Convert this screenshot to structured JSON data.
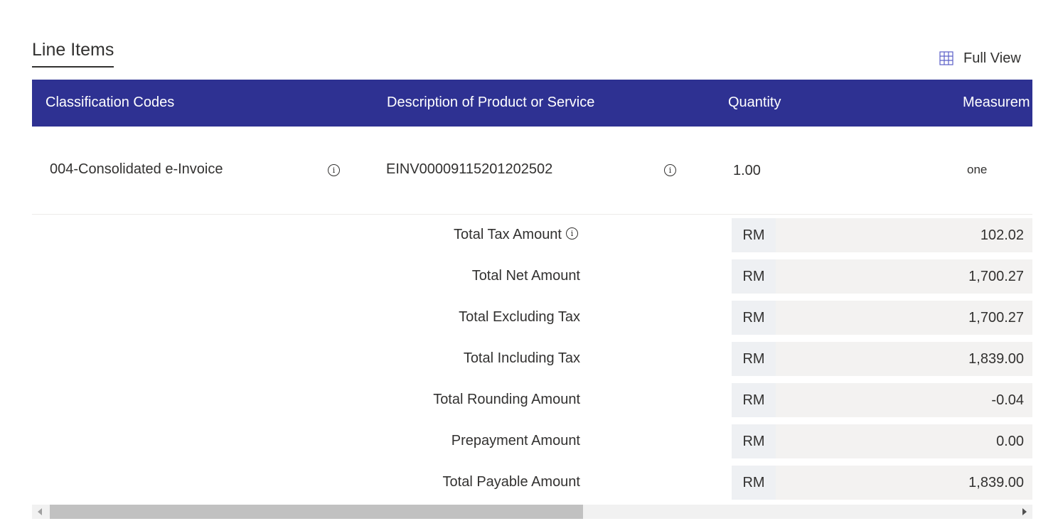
{
  "section": {
    "title": "Line Items"
  },
  "full_view": {
    "label": "Full View",
    "icon": "table-grid-icon"
  },
  "table": {
    "headers": [
      "Classification Codes",
      "Description of Product or Service",
      "Quantity",
      "Measurem"
    ],
    "rows": [
      {
        "classification": "004-Consolidated e-Invoice",
        "description": "EINV00009115201202502",
        "quantity": "1.00",
        "measurement": "one"
      }
    ]
  },
  "totals": [
    {
      "label": "Total Tax Amount",
      "currency": "RM",
      "amount": "102.02",
      "has_info": true
    },
    {
      "label": "Total Net Amount",
      "currency": "RM",
      "amount": "1,700.27"
    },
    {
      "label": "Total Excluding Tax",
      "currency": "RM",
      "amount": "1,700.27"
    },
    {
      "label": "Total Including Tax",
      "currency": "RM",
      "amount": "1,839.00"
    },
    {
      "label": "Total Rounding Amount",
      "currency": "RM",
      "amount": "-0.04"
    },
    {
      "label": "Prepayment Amount",
      "currency": "RM",
      "amount": "0.00"
    },
    {
      "label": "Total Payable Amount",
      "currency": "RM",
      "amount": "1,839.00"
    }
  ],
  "colors": {
    "header_bg": "#2e3192",
    "field_bg": "#f3f2f1",
    "text": "#323130"
  }
}
